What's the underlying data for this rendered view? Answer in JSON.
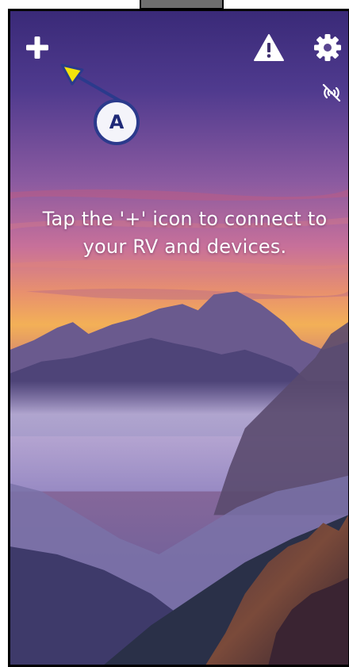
{
  "header": {
    "add_icon": "plus-icon",
    "alert_icon": "warning-triangle-icon",
    "settings_icon": "gear-icon",
    "signal_icon": "no-signal-icon"
  },
  "main": {
    "message": "Tap the '+' icon to connect to your RV and devices."
  },
  "annotation": {
    "label": "A",
    "arrow_fill": "#f3e40a",
    "arrow_stroke": "#2b3a8c"
  },
  "theme": {
    "icon_color": "#ffffff",
    "frame_border": "#000000"
  }
}
